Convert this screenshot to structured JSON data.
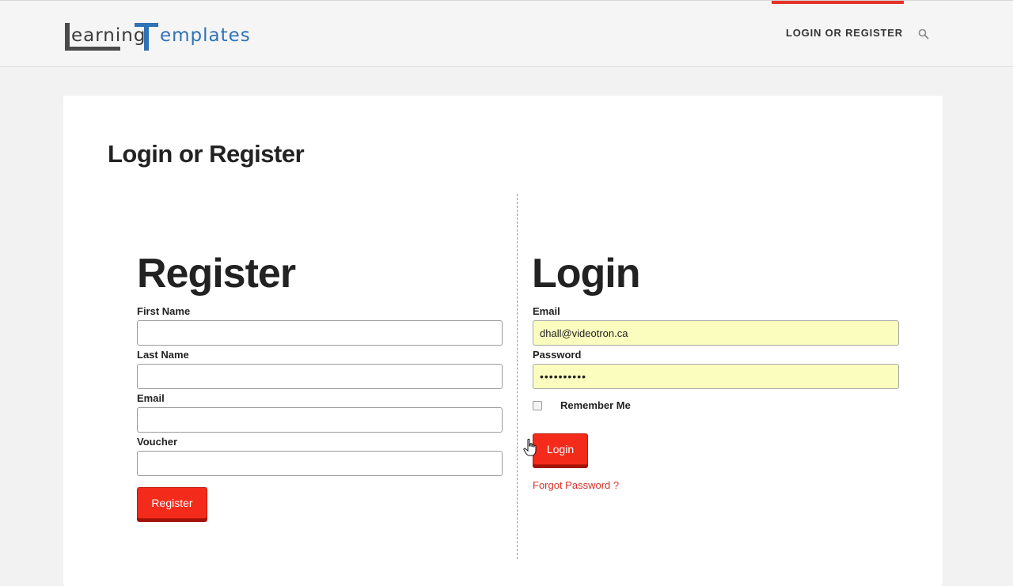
{
  "header": {
    "logo": {
      "part1": "earning",
      "part2": "emplates"
    },
    "nav_link": "LOGIN OR REGISTER",
    "search_icon": "search-icon",
    "accent_color": "#e6332a"
  },
  "page": {
    "title": "Login or Register"
  },
  "register": {
    "title": "Register",
    "first_name_label": "First Name",
    "first_name_value": "",
    "last_name_label": "Last Name",
    "last_name_value": "",
    "email_label": "Email",
    "email_value": "",
    "voucher_label": "Voucher",
    "voucher_value": "",
    "button": "Register"
  },
  "login": {
    "title": "Login",
    "email_label": "Email",
    "email_value": "dhall@videotron.ca",
    "password_label": "Password",
    "password_value": "••••••••••",
    "remember_label": "Remember Me",
    "remember_checked": false,
    "button": "Login",
    "forgot": "Forgot Password ?"
  },
  "colors": {
    "button_red": "#f42b1b",
    "link_red": "#d8322a",
    "autofill_yellow": "#fafdbd",
    "logo_blue": "#2f72b5"
  }
}
